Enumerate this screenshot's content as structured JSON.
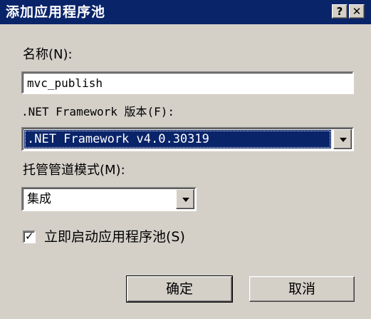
{
  "title": "添加应用程序池",
  "titlebar": {
    "help_label": "?",
    "close_label": "✕"
  },
  "name_label": "名称(N):",
  "name_value": "mvc_publish",
  "framework_label": ".NET Framework 版本(F):",
  "framework_value": ".NET Framework v4.0.30319",
  "pipeline_label": "托管管道模式(M):",
  "pipeline_value": "集成",
  "start_checkbox": {
    "checked": true,
    "label": "立即启动应用程序池(S)"
  },
  "buttons": {
    "ok": "确定",
    "cancel": "取消"
  },
  "icons": {
    "dropdown": "chevron-down-icon",
    "check": "check-icon"
  },
  "colors": {
    "titlebar": "#0a246a",
    "face": "#d4d0c8",
    "selection": "#0a246a"
  }
}
